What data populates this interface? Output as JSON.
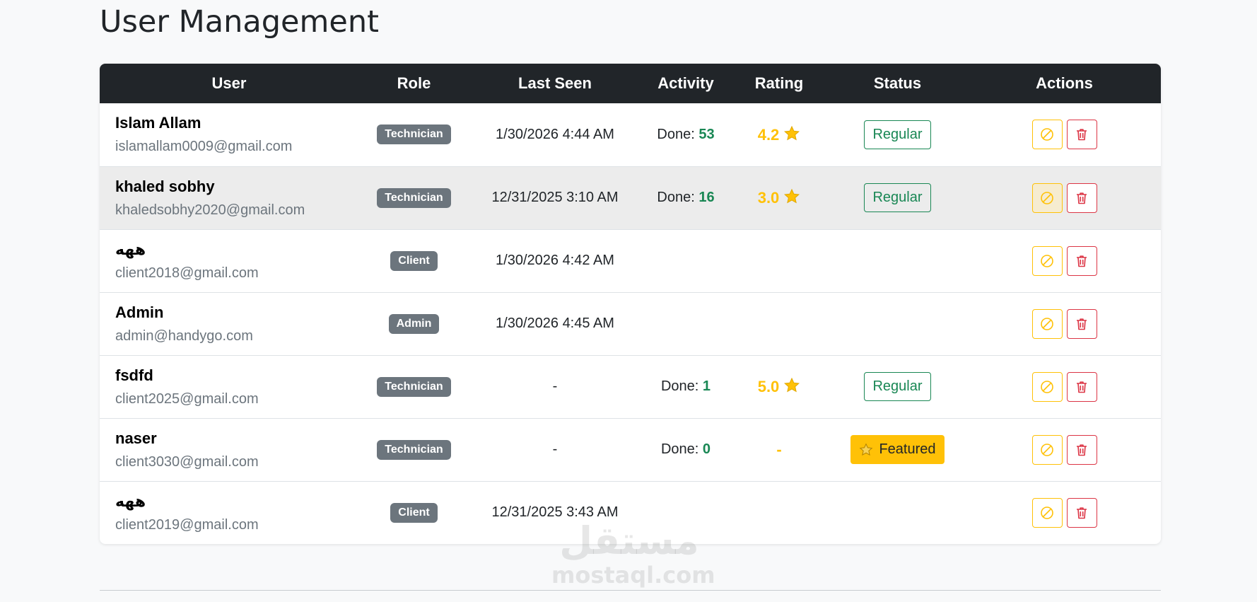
{
  "page": {
    "title": "User Management"
  },
  "table": {
    "headers": [
      "User",
      "Role",
      "Last Seen",
      "Activity",
      "Rating",
      "Status",
      "Actions"
    ],
    "activity_prefix": "Done: ",
    "rows": [
      {
        "name": "Islam Allam",
        "email": "islamallam0009@gmail.com",
        "role": "Technician",
        "last_seen": "1/30/2026 4:44 AM",
        "done": "53",
        "rating": "4.2",
        "status": "Regular",
        "status_type": "regular"
      },
      {
        "name": "khaled sobhy",
        "email": "khaledsobhy2020@gmail.com",
        "role": "Technician",
        "last_seen": "12/31/2025 3:10 AM",
        "done": "16",
        "rating": "3.0",
        "status": "Regular",
        "status_type": "regular"
      },
      {
        "name": "ههه",
        "email": "client2018@gmail.com",
        "role": "Client",
        "last_seen": "1/30/2026 4:42 AM",
        "done": null,
        "rating": null,
        "status": null,
        "status_type": "none"
      },
      {
        "name": "Admin",
        "email": "admin@handygo.com",
        "role": "Admin",
        "last_seen": "1/30/2026 4:45 AM",
        "done": null,
        "rating": null,
        "status": null,
        "status_type": "none"
      },
      {
        "name": "fsdfd",
        "email": "client2025@gmail.com",
        "role": "Technician",
        "last_seen": "-",
        "done": "1",
        "rating": "5.0",
        "status": "Regular",
        "status_type": "regular"
      },
      {
        "name": "naser",
        "email": "client3030@gmail.com",
        "role": "Technician",
        "last_seen": "-",
        "done": "0",
        "rating": "-",
        "status": "Featured",
        "status_type": "featured"
      },
      {
        "name": "ههه",
        "email": "client2019@gmail.com",
        "role": "Client",
        "last_seen": "12/31/2025 3:43 AM",
        "done": null,
        "rating": null,
        "status": null,
        "status_type": "none"
      }
    ],
    "hovered_row": 1
  },
  "icons": {
    "rating": "star-icon",
    "featured": "star-icon",
    "ban_action": "ban-icon",
    "delete_action": "trash-icon"
  },
  "colors": {
    "header_bg": "#212529",
    "role_badge": "#6c757d",
    "done_count": "#198754",
    "rating": "#ffc107",
    "regular_status": "#198754",
    "featured_status": "#ffc107",
    "delete": "#dc3545"
  },
  "watermark": {
    "mark": "مستقل",
    "text": "mostaql.com"
  }
}
